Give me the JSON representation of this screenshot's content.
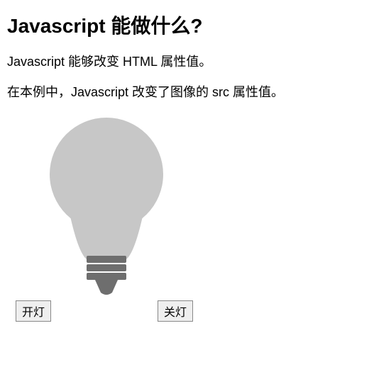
{
  "heading": "Javascript 能做什么?",
  "paragraph1": "Javascript 能够改变 HTML 属性值。",
  "paragraph2": "在本例中，Javascript 改变了图像的 src 属性值。",
  "buttons": {
    "on_label": "开灯",
    "off_label": "关灯"
  },
  "bulb": {
    "state": "off",
    "glass_color": "#c7c7c7",
    "base_color": "#6e6e6e"
  }
}
